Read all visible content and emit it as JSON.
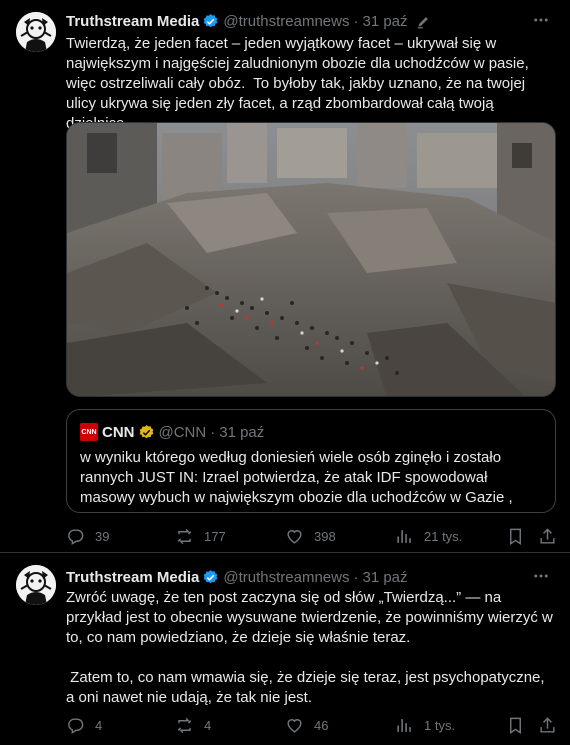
{
  "tweets": [
    {
      "author": {
        "name": "Truthstream Media",
        "handle": "@truthstreamnews",
        "date": "31 paź"
      },
      "text": "Twierdzą, że jeden facet – jeden wyjątkowy facet – ukrywał się w największym i najgęściej zaludnionym obozie dla uchodźców w pasie, więc ostrzeliwali cały obóz.  To byłoby tak, jakby uznano, że na twojej ulicy ukrywa się jeden zły facet, a rząd zbombardował całą twoją dzielnicę.",
      "quote": {
        "logo_text": "CNN",
        "name": "CNN",
        "handle": "@CNN",
        "date": "31 paź",
        "text": " w wyniku którego według doniesień wiele osób zginęło i zostało rannych JUST IN: Izrael potwierdza, że atak IDF spowodował masowy wybuch w największym obozie dla uchodźców w Gazie ,"
      },
      "stats": {
        "replies": "39",
        "reposts": "177",
        "likes": "398",
        "views": "21 tys."
      }
    },
    {
      "author": {
        "name": "Truthstream Media",
        "handle": "@truthstreamnews",
        "date": "31 paź"
      },
      "text": "Zwróć uwagę, że ten post zaczyna się od słów „Twierdzą...” — na przykład jest to obecnie wysuwane twierdzenie, że powinniśmy wierzyć w to, co nam powiedziano, że dzieje się właśnie teraz.\n\n Zatem to, co nam wmawia się, że dzieje się teraz, jest psychopatyczne, a oni nawet nie udają, że tak nie jest.",
      "stats": {
        "replies": "4",
        "reposts": "4",
        "likes": "46",
        "views": "1 tys."
      }
    }
  ],
  "colors": {
    "background": "#000000",
    "text": "#e7e9ea",
    "muted": "#71767b",
    "verified": "#1d9bf0",
    "gold": "#e2b719",
    "cnn": "#cc0000"
  },
  "icons": [
    "verified-badge-icon",
    "edit-icon",
    "more-icon",
    "reply-icon",
    "repost-icon",
    "like-icon",
    "views-icon",
    "bookmark-icon",
    "share-icon"
  ]
}
